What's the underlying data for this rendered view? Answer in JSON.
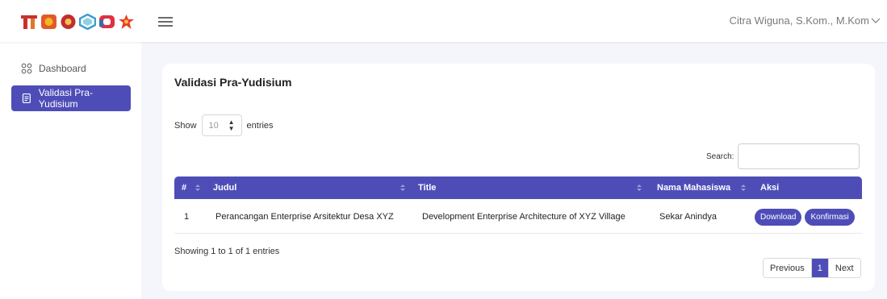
{
  "header": {
    "user_name": "Citra Wiguna, S.Kom., M.Kom"
  },
  "sidebar": {
    "items": [
      {
        "label": "Dashboard",
        "icon": "grid-icon",
        "active": false
      },
      {
        "label": "Validasi Pra-Yudisium",
        "icon": "document-icon",
        "active": true
      }
    ]
  },
  "main": {
    "title": "Validasi Pra-Yudisium",
    "show_label": "Show",
    "entries_label": "entries",
    "page_size": "10",
    "search_label": "Search:",
    "search_value": "",
    "table": {
      "columns": [
        "#",
        "Judul",
        "Title",
        "Nama Mahasiswa",
        "Aksi"
      ],
      "rows": [
        {
          "no": "1",
          "judul": "Perancangan Enterprise Arsitektur Desa XYZ",
          "title": "Development Enterprise Architecture of XYZ Village",
          "nama": "Sekar Anindya",
          "actions": [
            "Download",
            "Konfirmasi"
          ]
        }
      ]
    },
    "info": "Showing 1 to 1 of 1 entries",
    "pagination": {
      "previous": "Previous",
      "current": "1",
      "next": "Next"
    }
  },
  "colors": {
    "primary": "#4e4db8",
    "content_bg": "#f4f6fb"
  }
}
